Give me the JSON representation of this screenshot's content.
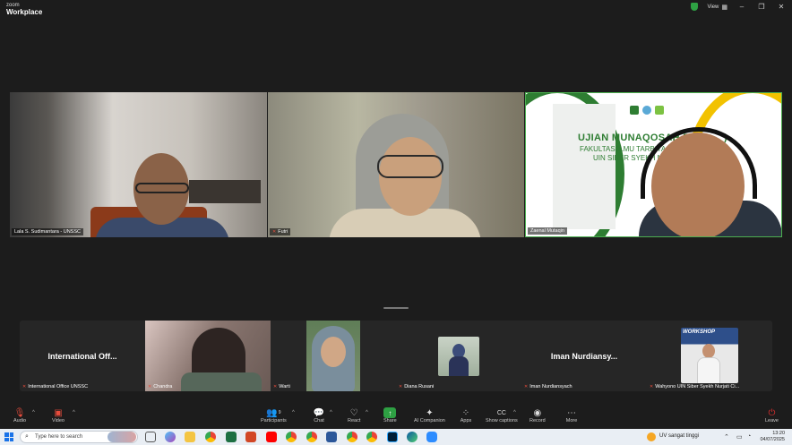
{
  "titlebar": {
    "brand_small": "zoom",
    "brand_main": "Workplace",
    "view_label": "View"
  },
  "tiles": [
    {
      "name": "Lala S. Sudimantara - UNSSC"
    },
    {
      "name": "Futri"
    },
    {
      "name": "Zaenal Mutaqin"
    }
  ],
  "slide": {
    "title": "UJIAN MUNAQOSAH P",
    "title_tail": ")",
    "line1": "FAKULTAS ILMU TARBIYA",
    "line2": "UIN SIBER SYEKH N"
  },
  "gallery": [
    {
      "label": "International Office UNSSC",
      "display_name": "International Off..."
    },
    {
      "label": "Chandra"
    },
    {
      "label": "Warti"
    },
    {
      "label": "Diana Rusani"
    },
    {
      "label": "Iman Nurdiansyach",
      "display_name": "Iman Nurdiansy..."
    },
    {
      "label": "Wahyono UIN Siber Syekh Nurjati Ci...",
      "poster_text": "WORKSHOP"
    }
  ],
  "toolbar": {
    "audio": "Audio",
    "video": "Video",
    "participants": "Participants",
    "participants_count": "9",
    "chat": "Chat",
    "react": "React",
    "share": "Share",
    "ai": "AI Companion",
    "apps": "Apps",
    "captions": "Show captions",
    "record": "Record",
    "more": "More",
    "leave": "Leave"
  },
  "taskbar": {
    "search_placeholder": "Type here to search",
    "weather": "UV sangat tinggi",
    "time": "13:20",
    "date": "04/07/2025"
  },
  "colors": {
    "accent_green": "#2e7d32",
    "slide_yellow": "#f2c200",
    "share_green": "#2ea043",
    "leave_red": "#e02f2f"
  }
}
